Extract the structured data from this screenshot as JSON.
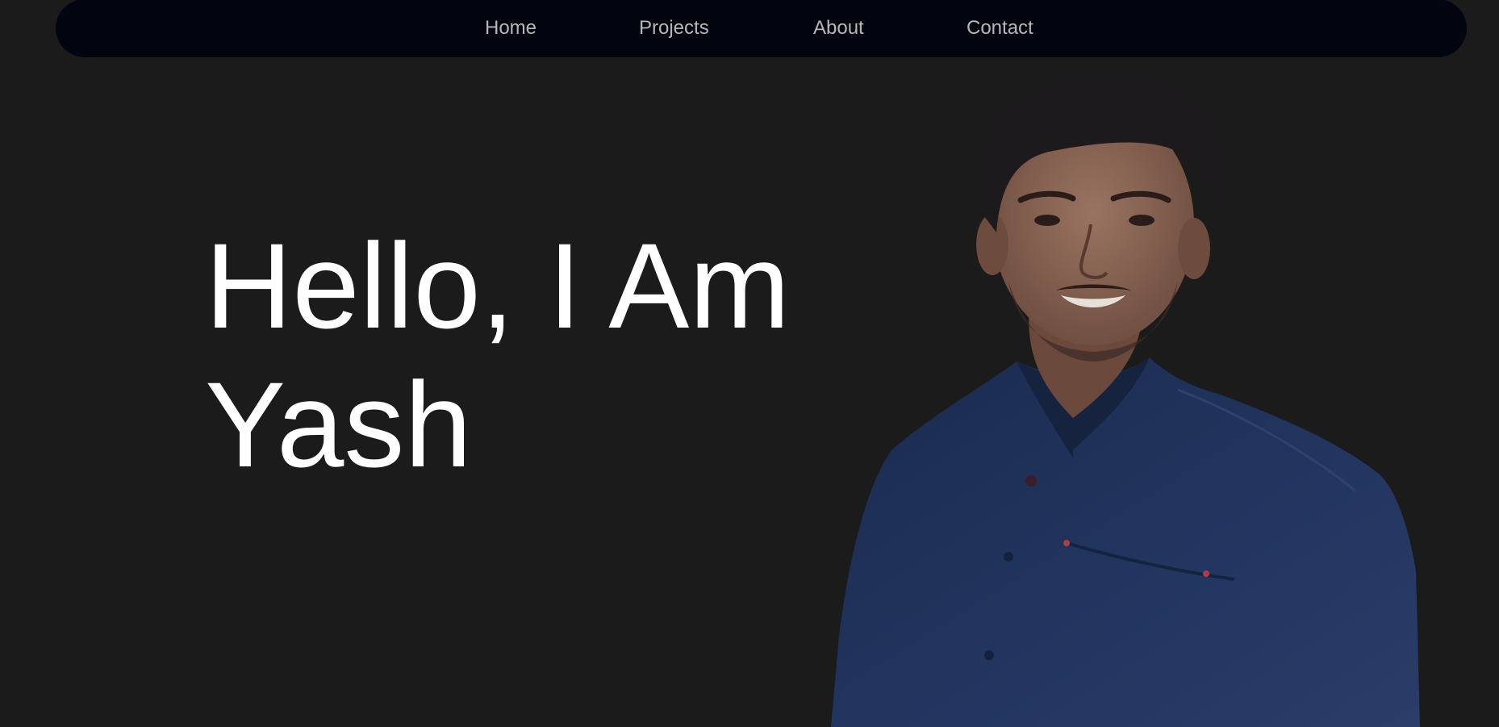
{
  "nav": {
    "links": [
      {
        "label": "Home"
      },
      {
        "label": "Projects"
      },
      {
        "label": "About"
      },
      {
        "label": "Contact"
      }
    ]
  },
  "hero": {
    "line1": "Hello, I Am",
    "line2": "Yash"
  },
  "colors": {
    "background": "#1b1b1b",
    "navbar": "#020510",
    "nav_text": "#b7b7b7",
    "headline": "#ffffff",
    "shirt": "#1e2f52"
  }
}
